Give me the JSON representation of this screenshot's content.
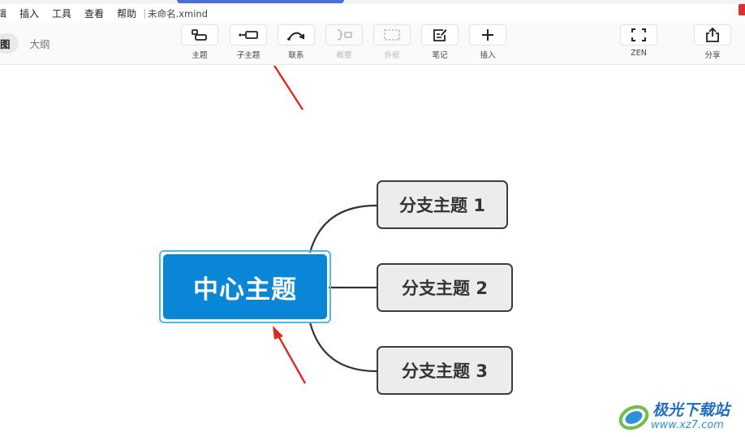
{
  "menu": {
    "items": [
      "辑",
      "插入",
      "工具",
      "查看",
      "帮助"
    ],
    "document_title": "未命名.xmind"
  },
  "view_switch": {
    "active": "图",
    "other": "大纲"
  },
  "toolbar": {
    "topic": {
      "label": "主题",
      "icon": "topic-icon"
    },
    "subtopic": {
      "label": "子主题",
      "icon": "subtopic-icon"
    },
    "relationship": {
      "label": "联系",
      "icon": "relationship-arrow-icon"
    },
    "summary": {
      "label": "概要",
      "icon": "summary-bracket-icon",
      "disabled": true
    },
    "boundary": {
      "label": "外框",
      "icon": "boundary-dashed-box-icon",
      "disabled": true
    },
    "notes": {
      "label": "笔记",
      "icon": "note-edit-icon"
    },
    "insert": {
      "label": "插入",
      "icon": "plus-icon"
    },
    "zen": {
      "label": "ZEN",
      "icon": "fullscreen-corners-icon"
    },
    "share": {
      "label": "分享",
      "icon": "share-upload-icon"
    }
  },
  "mindmap": {
    "central_topic": "中心主题",
    "branches": [
      "分支主题 1",
      "分支主题 2",
      "分支主题 3"
    ],
    "colors": {
      "central_fill": "#0a86d6",
      "central_outline": "#4fb8ec",
      "branch_fill": "#ececec",
      "branch_border": "#3d3d3d",
      "annotation_arrow": "#e02a21"
    }
  },
  "watermark": {
    "text": "极光下载站",
    "url": "www.xz7.com"
  }
}
